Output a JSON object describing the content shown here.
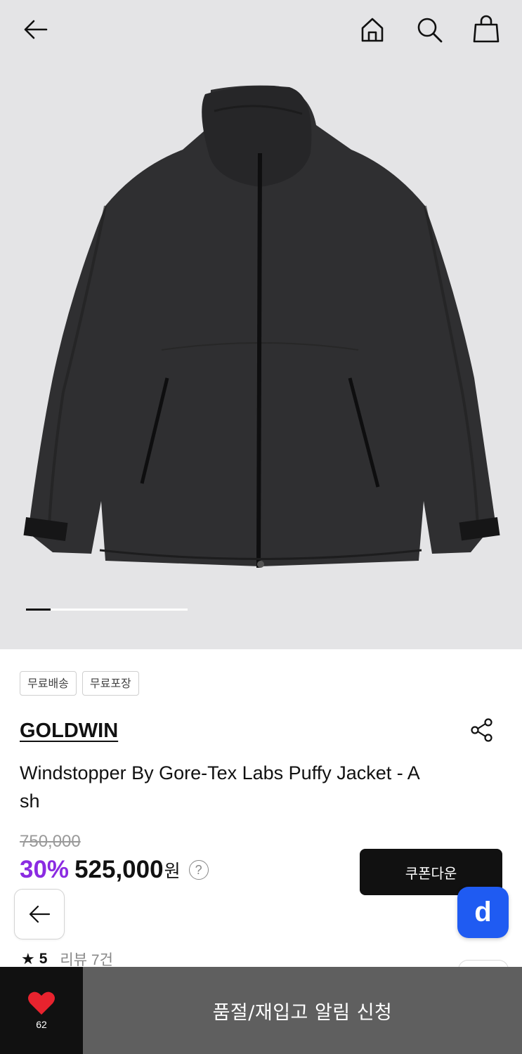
{
  "header": {
    "back_icon": "arrow-left-icon",
    "home_icon": "home-icon",
    "search_icon": "search-icon",
    "cart_icon": "shopping-bag-icon"
  },
  "gallery": {
    "image_subject": "black puffy jacket with full zip and stand collar",
    "current_slide_fraction": 0.15
  },
  "tags": [
    "무료배송",
    "무료포장"
  ],
  "product": {
    "brand": "GOLDWIN",
    "title": "Windstopper By Gore-Tex Labs Puffy Jacket - Ash",
    "original_price": "750,000",
    "discount": "30%",
    "price": "525,000",
    "currency": "원",
    "help_symbol": "?"
  },
  "coupon_button": "쿠폰다운",
  "rating": {
    "score": "5",
    "reviews": "리뷰 7건"
  },
  "bottom_bar": {
    "like_count": "62",
    "restock_label": "품절/재입고 알림 신청"
  },
  "floating": {
    "d_label": "d"
  },
  "colors": {
    "discount": "#8b2be2",
    "d_button": "#1f5bf2",
    "restock_bar": "#5f5f5f",
    "heart": "#e8232e"
  }
}
